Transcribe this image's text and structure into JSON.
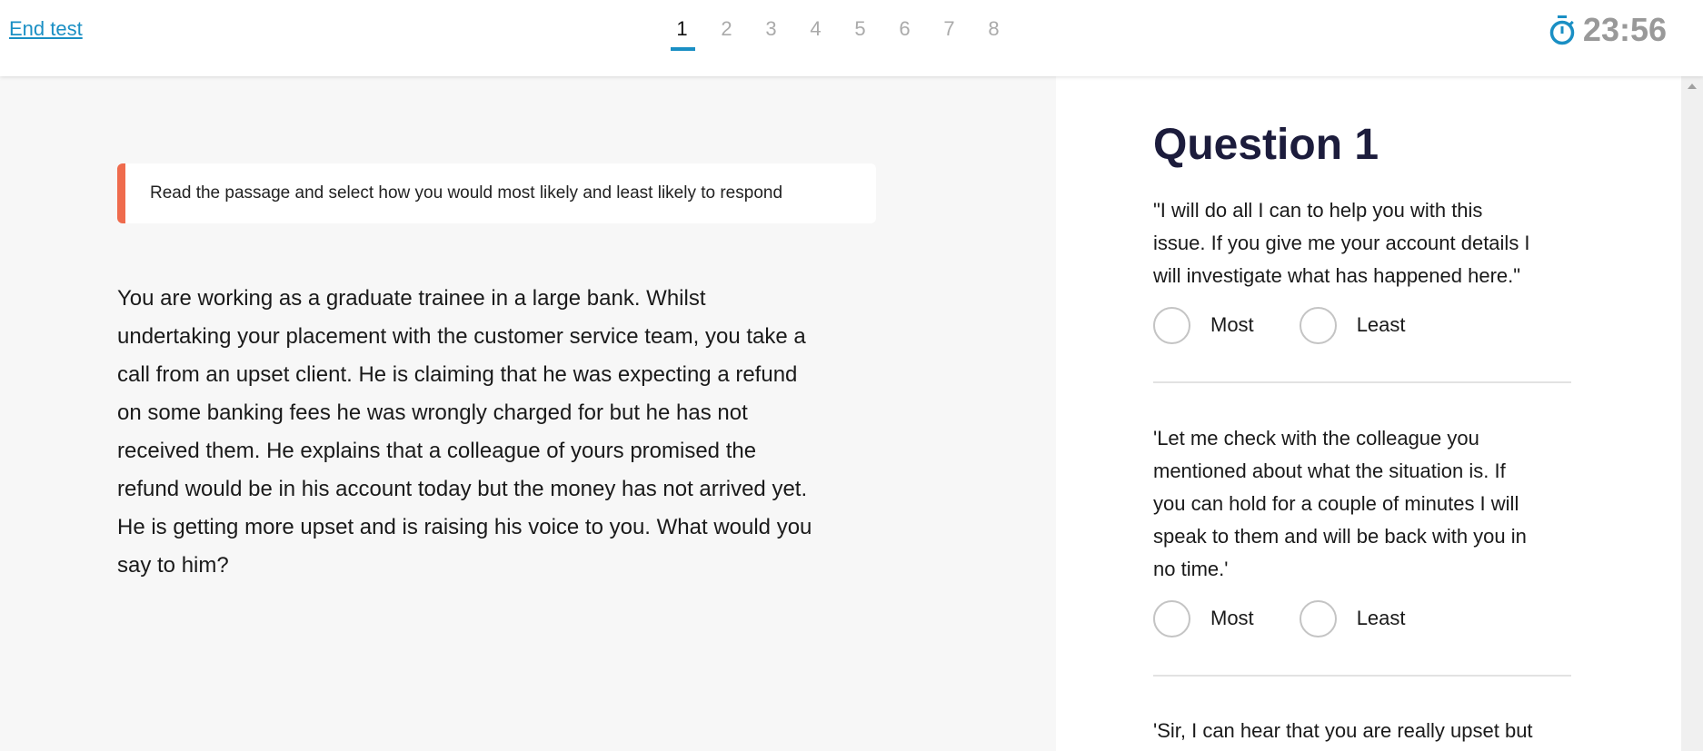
{
  "header": {
    "end_test_label": "End test",
    "pages": [
      "1",
      "2",
      "3",
      "4",
      "5",
      "6",
      "7",
      "8"
    ],
    "active_page": "1",
    "timer": "23:56",
    "timer_icon": "stopwatch-icon",
    "accent_color": "#1a8fc4"
  },
  "instruction": "Read the passage and select how you would most likely and least likely to respond",
  "passage_lines": [
    "You are working as a graduate trainee in a large bank. Whilst",
    "undertaking your placement with the customer service team, you take a",
    "call from an upset client. He is claiming that he was expecting a refund",
    "on some banking fees he was wrongly charged for but he has not",
    "received them. He explains that a colleague of yours promised the",
    "refund would be in his account today but the money has not arrived yet.",
    "He is getting more upset and is raising his voice to you. What would you",
    "say to him?"
  ],
  "question": {
    "title": "Question 1",
    "most_label": "Most",
    "least_label": "Least",
    "options": [
      {
        "lines": [
          "\"I will do all I can to help you with this",
          "issue. If you give me your account details I",
          "will investigate what has happened here.\""
        ]
      },
      {
        "lines": [
          "'Let me check with the colleague you",
          "mentioned about what the situation is. If",
          "you can hold for a couple of minutes I will",
          "speak to them and will be back with you in",
          "no time.'"
        ]
      },
      {
        "lines": [
          "'Sir, I can hear that you are really upset but"
        ]
      }
    ]
  }
}
